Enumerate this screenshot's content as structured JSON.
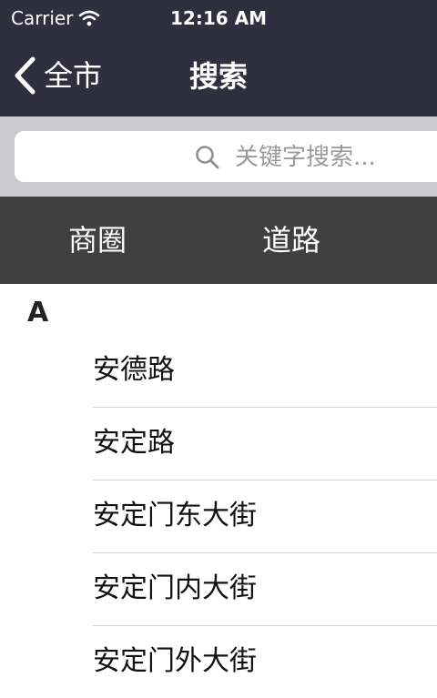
{
  "status_bar": {
    "carrier": "Carrier",
    "time": "12:16 AM"
  },
  "nav": {
    "back_label": "全市",
    "title": "搜索"
  },
  "search": {
    "placeholder": "关键字搜索..."
  },
  "tabs": [
    {
      "label": "商圈"
    },
    {
      "label": "道路"
    }
  ],
  "list": {
    "sections": [
      {
        "header": "A",
        "items": [
          {
            "label": "安德路"
          },
          {
            "label": "安定路"
          },
          {
            "label": "安定门东大街"
          },
          {
            "label": "安定门内大街"
          },
          {
            "label": "安定门外大街"
          }
        ]
      }
    ]
  },
  "colors": {
    "nav_bg": "#2f2f40",
    "search_bg": "#c9c9ce",
    "tabs_bg": "#404040",
    "separator": "#d4d4d4"
  },
  "icons": [
    "wifi-icon",
    "back-chevron-icon",
    "search-icon"
  ]
}
